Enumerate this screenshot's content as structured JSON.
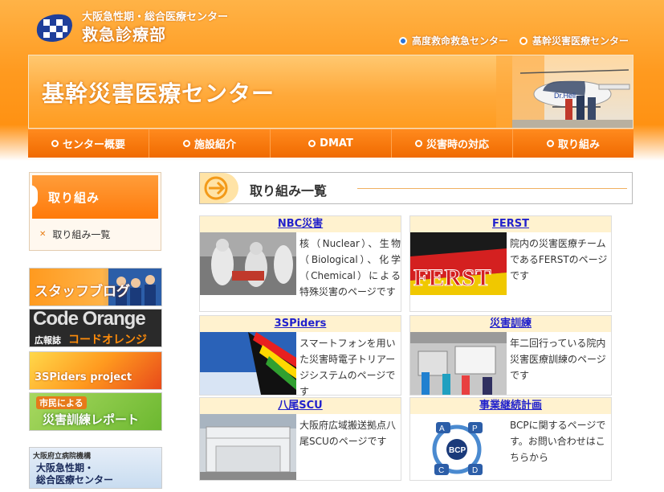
{
  "header": {
    "org": "大阪急性期・総合医療センター",
    "dept": "救急診療部",
    "links": [
      {
        "label": "高度救命救急センター"
      },
      {
        "label": "基幹災害医療センター"
      }
    ]
  },
  "banner": {
    "title": "基幹災害医療センター"
  },
  "nav": [
    {
      "label": "センター概要"
    },
    {
      "label": "施設紹介"
    },
    {
      "label": "DMAT"
    },
    {
      "label": "災害時の対応"
    },
    {
      "label": "取り組み"
    }
  ],
  "sidebar": {
    "heading": "取り組み",
    "links": [
      {
        "label": "取り組み一覧"
      }
    ],
    "banners": [
      {
        "line1": "スタッフブログ"
      },
      {
        "line1": "Code Orange",
        "line2": "広報誌",
        "line3": "コードオレンジ"
      },
      {
        "line1": "3SPiders project"
      },
      {
        "line1": "市民による",
        "line2": "災害訓練レポート"
      },
      {
        "line1": "大阪府立病院機構",
        "line2": "大阪急性期・",
        "line3": "総合医療センター"
      }
    ]
  },
  "main": {
    "heading": "取り組み一覧",
    "cards": [
      {
        "title": "NBC災害",
        "text": "核（Nuclear）、生物（Biological）、化学（Chemical）による特殊災害のページです"
      },
      {
        "title": "FERST",
        "text": "院内の災害医療チームであるFERSTのページです"
      },
      {
        "title": "3SPiders",
        "text": "スマートフォンを用いた災害時電子トリアージシステムのページです"
      },
      {
        "title": "災害訓練",
        "text": "年二回行っている院内災害医療訓練のページです"
      },
      {
        "title": "八尾SCU",
        "text": "大阪府広域搬送拠点八尾SCUのページです"
      },
      {
        "title": "事業継続計画",
        "text": "BCPに関するページです。お問い合わせはこちらから"
      }
    ]
  },
  "colors": {
    "accent": "#ff8c0a",
    "link": "#2222cc",
    "card_title_bg": "#fff2cf"
  }
}
